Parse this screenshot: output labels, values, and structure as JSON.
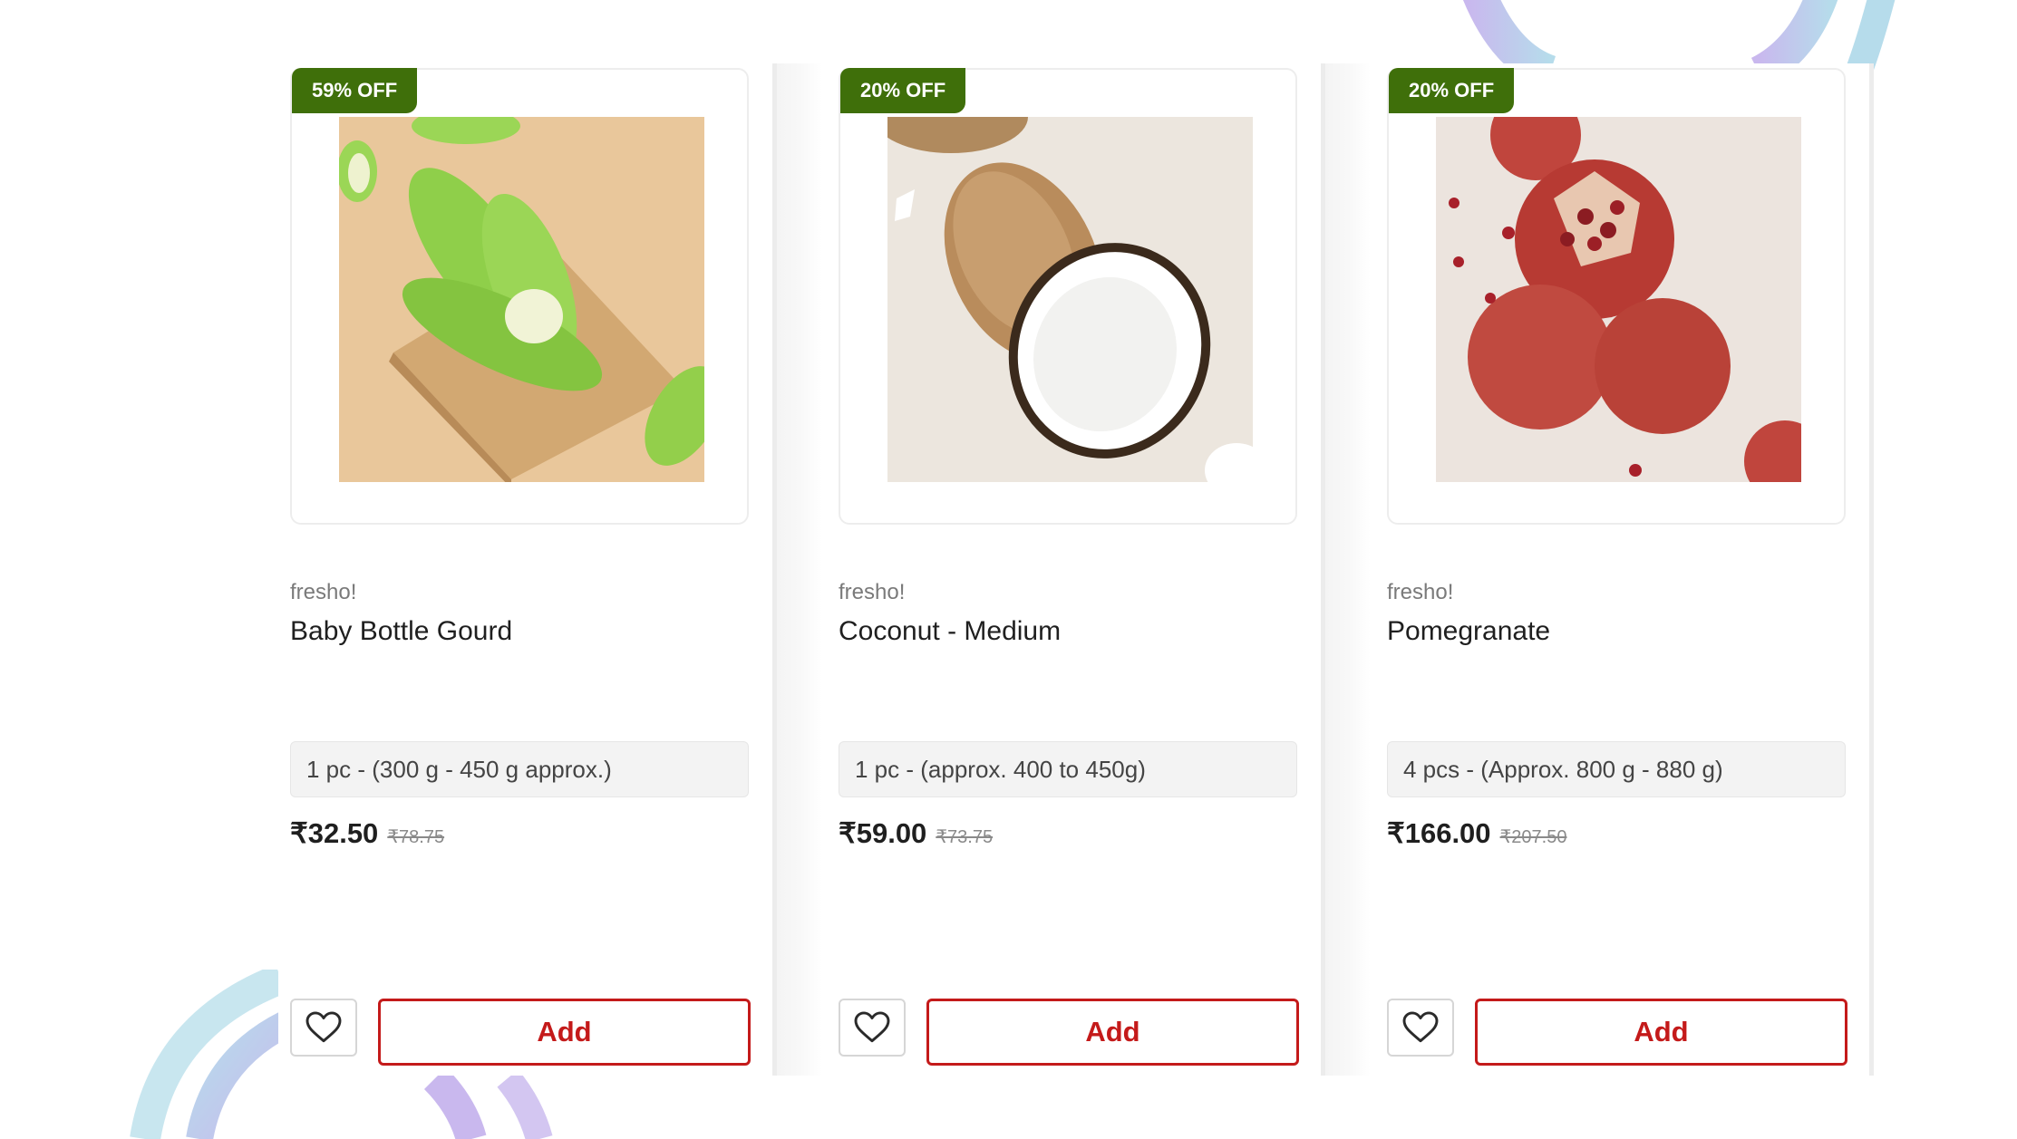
{
  "colors": {
    "badge_green": "#3f6f0a",
    "add_red": "#c41a1a",
    "deco_purple": "#c9b8ee",
    "deco_blue": "#b6dceb"
  },
  "products": [
    {
      "discount": "59% OFF",
      "brand": "fresho!",
      "name": "Baby Bottle Gourd",
      "pack_size": "1 pc - (300 g - 450 g approx.)",
      "price": "₹32.50",
      "mrp": "₹78.75",
      "add_label": "Add",
      "wishlist_icon": "heart-outline-icon",
      "image": "bottle-gourd-image"
    },
    {
      "discount": "20% OFF",
      "brand": "fresho!",
      "name": "Coconut - Medium",
      "pack_size": "1 pc - (approx. 400 to 450g)",
      "price": "₹59.00",
      "mrp": "₹73.75",
      "add_label": "Add",
      "wishlist_icon": "heart-outline-icon",
      "image": "coconut-image"
    },
    {
      "discount": "20% OFF",
      "brand": "fresho!",
      "name": "Pomegranate",
      "pack_size": "4 pcs - (Approx. 800 g - 880 g)",
      "price": "₹166.00",
      "mrp": "₹207.50",
      "add_label": "Add",
      "wishlist_icon": "heart-outline-icon",
      "image": "pomegranate-image"
    }
  ]
}
